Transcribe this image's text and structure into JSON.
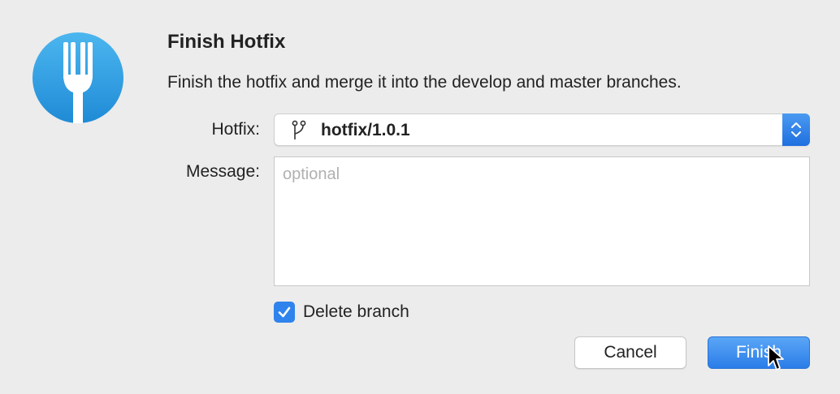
{
  "dialog": {
    "title": "Finish Hotfix",
    "description": "Finish the hotfix and merge it into the develop and master branches."
  },
  "hotfix_field": {
    "label": "Hotfix:",
    "selected_value": "hotfix/1.0.1",
    "icon": "git-branch-icon"
  },
  "message_field": {
    "label": "Message:",
    "value": "",
    "placeholder": "optional"
  },
  "delete_branch": {
    "label": "Delete branch",
    "checked": true
  },
  "buttons": {
    "cancel_label": "Cancel",
    "finish_label": "Finish"
  },
  "colors": {
    "app_icon": "#36a3e6",
    "accent": "#2f83ec",
    "background": "#ececec"
  }
}
